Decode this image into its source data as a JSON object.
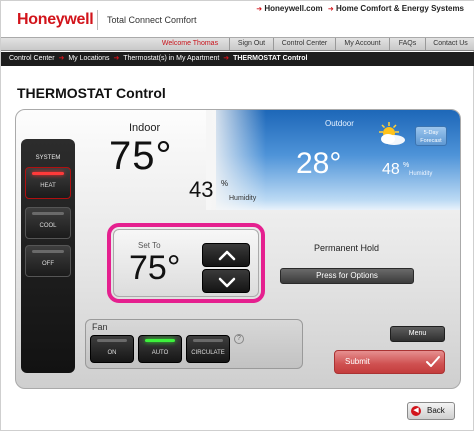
{
  "header": {
    "brand": "Honeywell",
    "product": "Total Connect Comfort",
    "ext_links": [
      "Honeywell.com",
      "Home Comfort & Energy Systems"
    ]
  },
  "nav": {
    "welcome": "Welcome Thomas",
    "items": [
      "Sign Out",
      "Control Center",
      "My Account",
      "FAQs",
      "Contact Us"
    ]
  },
  "breadcrumb": [
    "Control Center",
    "My Locations",
    "Thermostat(s) in My Apartment",
    "THERMOSTAT Control"
  ],
  "page_title": "THERMOSTAT Control",
  "system": {
    "label": "SYSTEM",
    "modes": [
      "HEAT",
      "COOL",
      "OFF"
    ],
    "active_mode": "HEAT"
  },
  "indoor": {
    "label": "Indoor",
    "temp": "75°",
    "humidity": "43",
    "humidity_unit": "%",
    "humidity_label": "Humidity"
  },
  "outdoor": {
    "label": "Outdoor",
    "temp": "28°",
    "humidity": "48",
    "humidity_unit": "%",
    "humidity_label": "Humidity",
    "forecast_line1": "5-Day",
    "forecast_line2": "Forecast",
    "weather_icon": "partly-sunny-icon"
  },
  "setpoint": {
    "label": "Set To",
    "temp": "75°"
  },
  "hold": {
    "label": "Permanent Hold",
    "options_button": "Press for Options"
  },
  "fan": {
    "label": "Fan",
    "modes": [
      "ON",
      "AUTO",
      "CIRCULATE"
    ],
    "active_mode": "AUTO",
    "help": "?"
  },
  "actions": {
    "menu": "Menu",
    "submit": "Submit",
    "back": "Back"
  },
  "colors": {
    "brand": "#d2141b",
    "highlight": "#e5208f",
    "led_heat": "#ff3a3a",
    "led_fan": "#3cf23c",
    "submit": "#cf5050"
  }
}
